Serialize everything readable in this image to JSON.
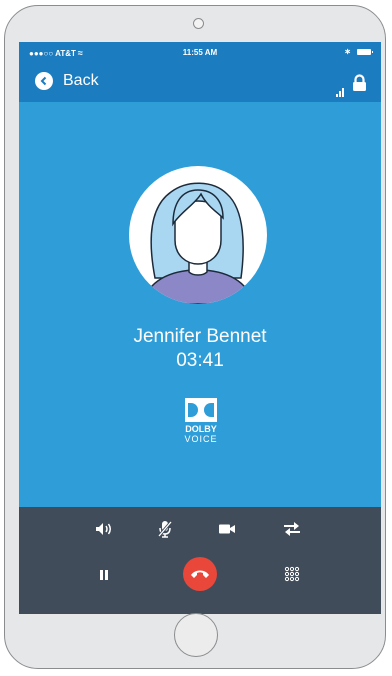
{
  "status_bar": {
    "carrier": "AT&T",
    "time": "11:55 AM"
  },
  "nav": {
    "back_label": "Back"
  },
  "call": {
    "contact_name": "Jennifer Bennet",
    "duration": "03:41"
  },
  "branding": {
    "line1": "DOLBY",
    "line2": "VOICE"
  },
  "controls": {
    "row1": [
      "speaker-icon",
      "mute-microphone-icon",
      "video-camera-icon",
      "transfer-icon"
    ],
    "row2": [
      "pause-icon",
      "end-call-icon",
      "keypad-icon"
    ]
  },
  "colors": {
    "screen_bg": "#2f9ed8",
    "header_bg": "#1c7cc0",
    "controls_bg": "#414c5a",
    "end_call": "#e8473a",
    "avatar_shirt": "#8c88c8",
    "avatar_hair": "#a9d7f1"
  }
}
